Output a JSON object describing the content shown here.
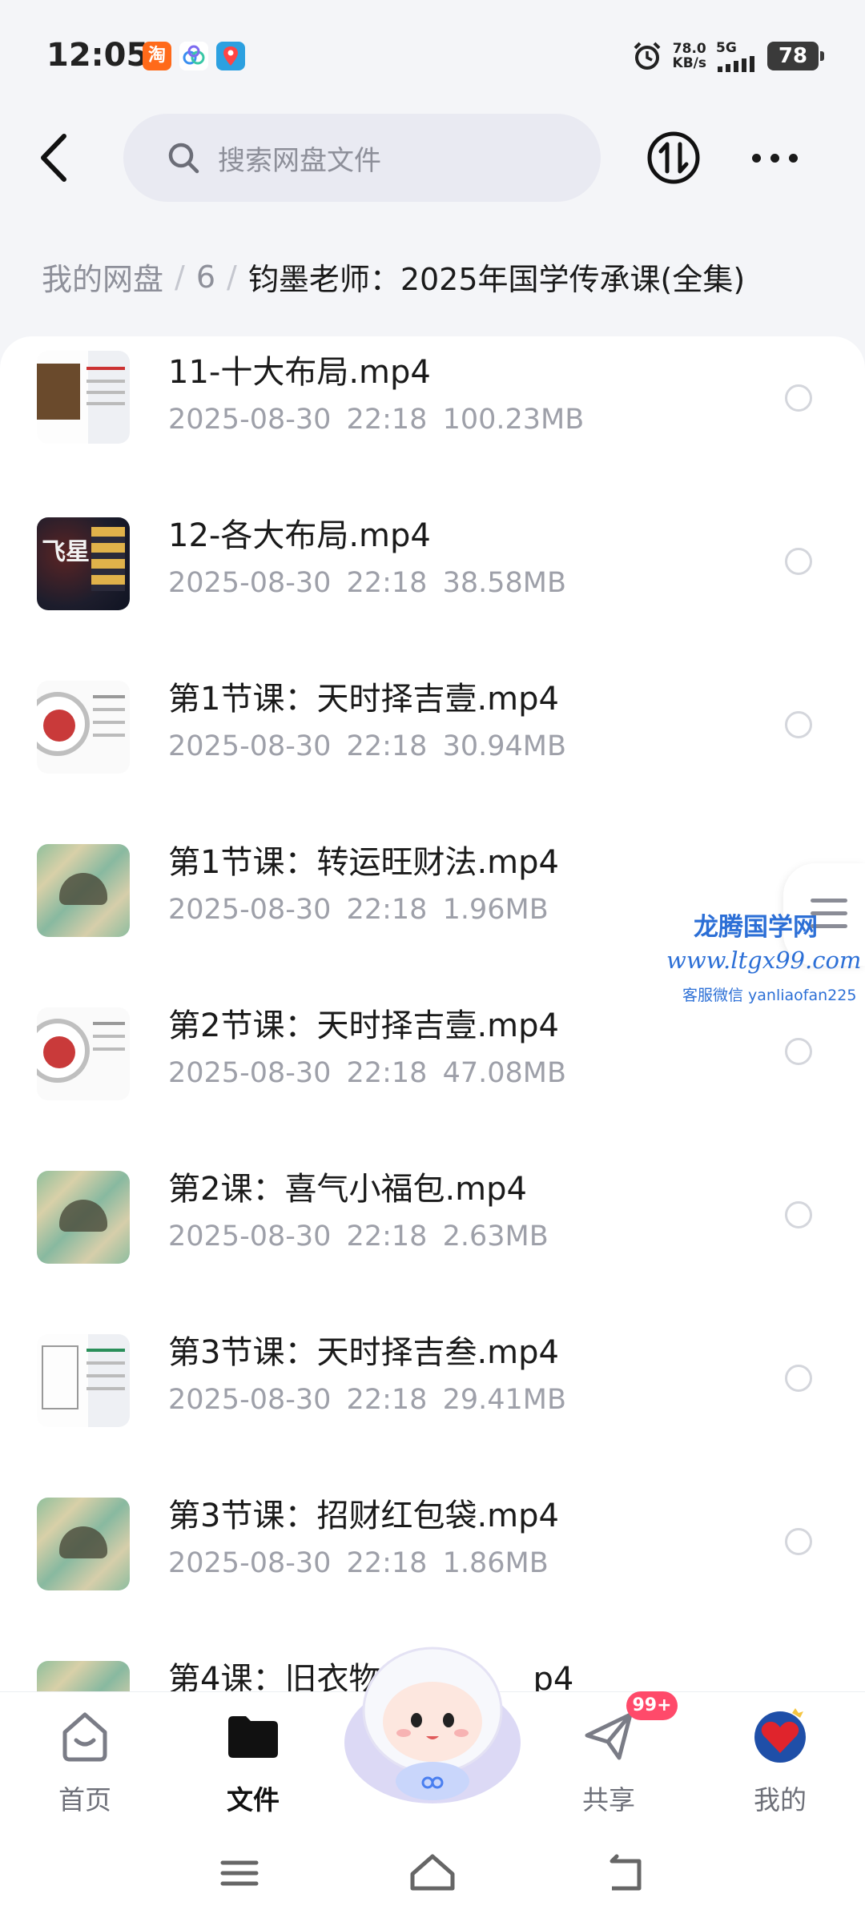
{
  "status_bar": {
    "time": "12:05",
    "apps": [
      {
        "icon": "taobao-icon",
        "glyph": "淘",
        "color": "#ff6a1a"
      },
      {
        "icon": "cloud-drive-icon",
        "glyph": "",
        "color": "#ffffff"
      },
      {
        "icon": "maps-icon",
        "glyph": "",
        "color": "#2ca0e0"
      }
    ],
    "alarm_icon": "alarm-clock-icon",
    "net_speed_value": "78.0",
    "net_speed_unit": "KB/s",
    "network": "5G",
    "battery": "78"
  },
  "header": {
    "back_icon": "chevron-left-icon",
    "search_placeholder": "搜索网盘文件",
    "sort_icon": "sort-updown-icon",
    "more_icon": "more-dots-icon"
  },
  "breadcrumb": {
    "root": "我的网盘",
    "sep": "/",
    "level1": "6",
    "current": "钧墨老师：2025年国学传承课(全集)"
  },
  "files": [
    {
      "name": "11-十大布局.mp4",
      "date": "2025-08-30",
      "time": "22:18",
      "size": "100.23MB",
      "thumb": "doc"
    },
    {
      "name": "12-各大布局.mp4",
      "date": "2025-08-30",
      "time": "22:18",
      "size": "38.58MB",
      "thumb": "dark"
    },
    {
      "name": "第1节课：天时择吉壹.mp4",
      "date": "2025-08-30",
      "time": "22:18",
      "size": "30.94MB",
      "thumb": "wheel"
    },
    {
      "name": "第1节课：转运旺财法.mp4",
      "date": "2025-08-30",
      "time": "22:18",
      "size": "1.96MB",
      "thumb": "map"
    },
    {
      "name": "第2节课：天时择吉壹.mp4",
      "date": "2025-08-30",
      "time": "22:18",
      "size": "47.08MB",
      "thumb": "wheel"
    },
    {
      "name": "第2课：喜气小福包.mp4",
      "date": "2025-08-30",
      "time": "22:18",
      "size": "2.63MB",
      "thumb": "map"
    },
    {
      "name": "第3节课：天时择吉叁.mp4",
      "date": "2025-08-30",
      "time": "22:18",
      "size": "29.41MB",
      "thumb": "doc"
    },
    {
      "name": "第3节课：招财红包袋.mp4",
      "date": "2025-08-30",
      "time": "22:18",
      "size": "1.86MB",
      "thumb": "map"
    },
    {
      "name": "第4课：旧衣物",
      "name_tail": "p4",
      "date": "",
      "time": "",
      "size": "",
      "thumb": "map"
    }
  ],
  "watermark": {
    "line1": "龙腾国学网",
    "line2": "www.ltgx99.com",
    "line3": "客服微信 yanliaofan225"
  },
  "side_handle_icon": "menu-lines-icon",
  "bottom_nav": {
    "items": [
      {
        "label": "首页",
        "icon": "home-icon",
        "active": false
      },
      {
        "label": "文件",
        "icon": "folder-icon",
        "active": true
      },
      {
        "label": "共享",
        "icon": "paper-plane-icon",
        "active": false
      },
      {
        "label": "我的",
        "icon": "heart-avatar-icon",
        "active": false
      }
    ],
    "share_badge": "99+",
    "center_icon": "mascot-icon"
  },
  "system_nav": {
    "menu_icon": "menu-icon",
    "home_icon": "home-outline-icon",
    "back_icon": "back-arrow-icon"
  }
}
